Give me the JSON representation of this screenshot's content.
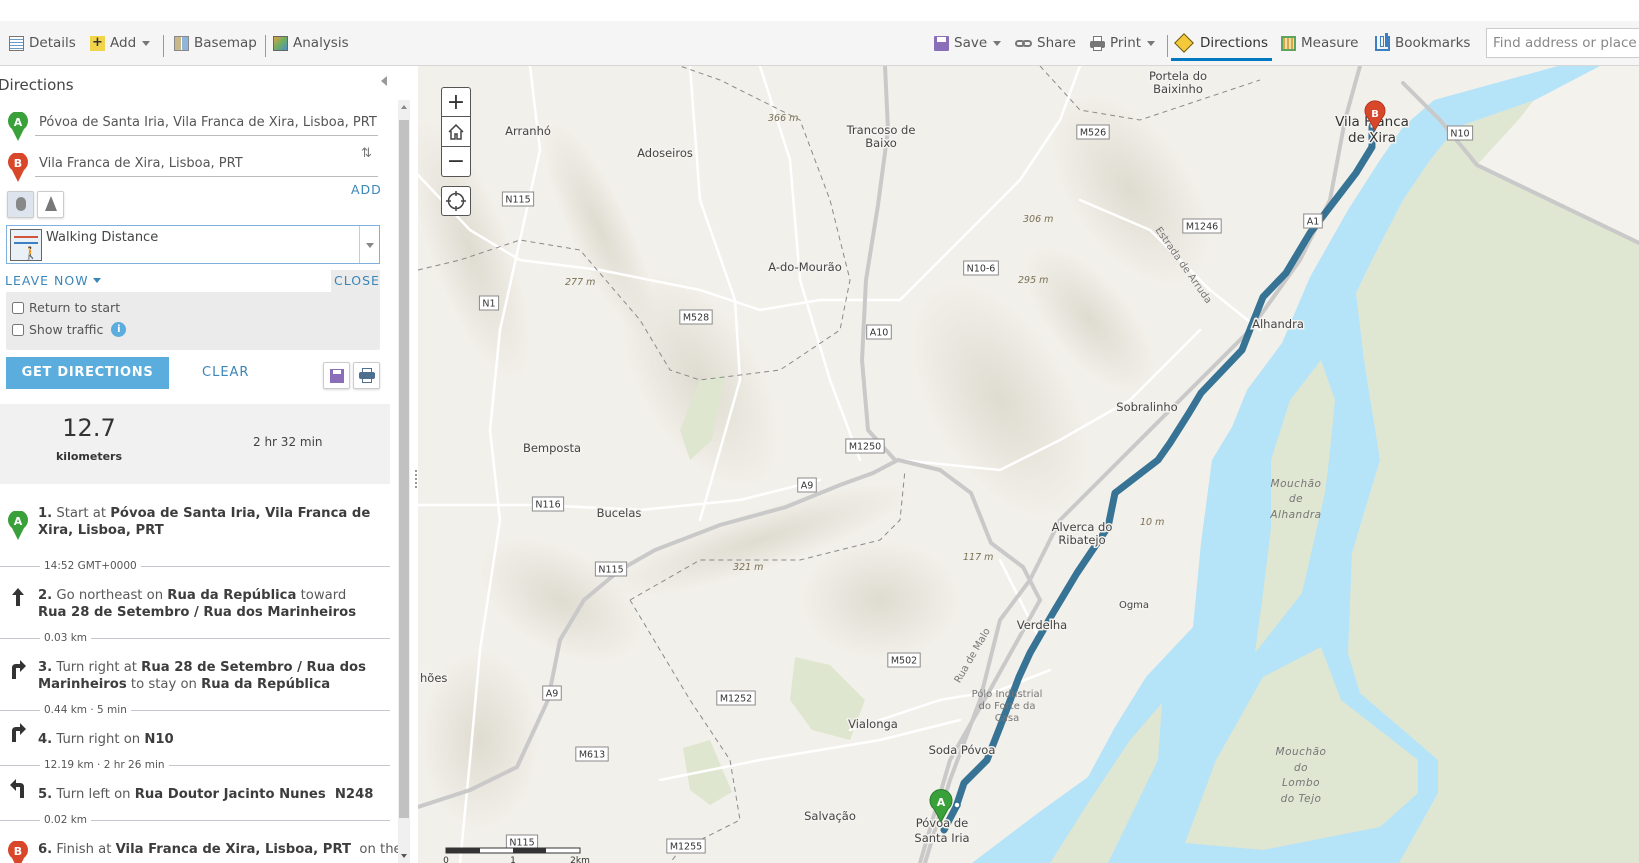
{
  "toolbar": {
    "details": "Details",
    "add": "Add",
    "basemap": "Basemap",
    "analysis": "Analysis",
    "save": "Save",
    "share": "Share",
    "print": "Print",
    "directions": "Directions",
    "measure": "Measure",
    "bookmarks": "Bookmarks",
    "search_placeholder": "Find address or place"
  },
  "directions": {
    "title": "Directions",
    "stop_a_marker": "A",
    "stop_b_marker": "B",
    "stop_a": "Póvoa de Santa Iria, Vila Franca de Xira, Lisboa, PRT",
    "stop_b": "Vila Franca de Xira, Lisboa, PRT",
    "add": "ADD",
    "travel_mode": "Walking Distance",
    "leave_now": "LEAVE NOW",
    "close": "CLOSE",
    "return_to_start": "Return to start",
    "show_traffic": "Show traffic",
    "get_directions": "GET DIRECTIONS",
    "clear": "CLEAR"
  },
  "summary": {
    "distance": "12.7",
    "distance_unit": "kilometers",
    "time": "2 hr 32 min"
  },
  "steps": [
    {
      "num": "1.",
      "parts": [
        "Start at ",
        "Póvoa de Santa Iria, Vila Franca de Xira, Lisboa, PRT"
      ]
    },
    {
      "num": "2.",
      "parts": [
        "Go northeast on ",
        "Rua da República",
        " toward ",
        "Rua 28 de Setembro / Rua dos Marinheiros"
      ]
    },
    {
      "num": "3.",
      "parts": [
        "Turn right at ",
        "Rua 28 de Setembro / Rua dos Marinheiros",
        " to stay on ",
        "Rua da República"
      ]
    },
    {
      "num": "4.",
      "parts": [
        "Turn right on ",
        "N10"
      ]
    },
    {
      "num": "5.",
      "parts": [
        "Turn left on ",
        "Rua Doutor Jacinto Nunes  N248"
      ]
    },
    {
      "num": "6.",
      "parts": [
        "Finish at ",
        "Vila Franca de Xira, Lisboa, PRT",
        "  on the left"
      ]
    }
  ],
  "separators": [
    "14:52 GMT+0000",
    "0.03 km",
    "0.44 km · 5 min",
    "12.19 km · 2 hr 26 min",
    "0.02 km"
  ],
  "map": {
    "labels": [
      "Arranhó",
      "Adoseiros",
      "Trancoso de",
      "Baixo",
      "A-do-Mourão",
      "Bemposta",
      "Portela do",
      "Baixinho",
      "Vila Franca",
      "de Xira",
      "Alhandra",
      "Sobralinho",
      "Bucelas",
      "Alverca do",
      "Ribatejo",
      "Ogma",
      "Verdelha",
      "Vialonga",
      "Soda Póvoa",
      "Salvação",
      "Póvoa de",
      "Santa Iria",
      "hões",
      "Pólo Industrial",
      "do Forte da",
      "Casa",
      "Mouchão",
      "de",
      "Alhandra",
      "Mouchão",
      "do",
      "Lombo",
      "do Tejo",
      "Estrada de Arruda",
      "Rua de Malo"
    ],
    "elevations": [
      "366 m",
      "306 m",
      "277 m",
      "295 m",
      "321 m",
      "117 m",
      "10 m"
    ],
    "shields": [
      "N115",
      "N1",
      "M528",
      "A10",
      "N10-6",
      "M1250",
      "M526",
      "N10",
      "A1",
      "M1246",
      "A9",
      "N116",
      "N115",
      "M502",
      "A9",
      "M1252",
      "M613",
      "N115",
      "M1255"
    ],
    "scale": [
      "0",
      "1",
      "2km"
    ],
    "zoom_in": "+",
    "zoom_out": "−"
  },
  "colors": {
    "accent": "#0079c1",
    "button": "#5aaddd",
    "route": "#2c6b8f",
    "water": "#b5e3f8",
    "marsh": "#dfe6d2",
    "stop_a": "#3aa13a",
    "stop_b": "#d9472b"
  }
}
